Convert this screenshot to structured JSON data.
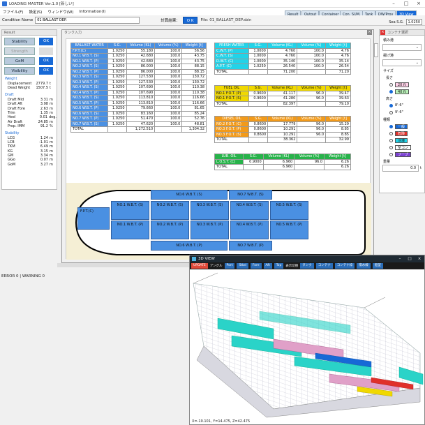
{
  "app": {
    "title": "LOADING MASTER Ver.1.0 [新しい]",
    "menu": [
      "ファイル(F)",
      "設定(S)",
      "ウィンドウ(W)",
      "Information(I)"
    ],
    "condition_label": "Condition Name",
    "condition_value": "01 BALLAST DEP.",
    "calc_label": "計算結果：",
    "ok_label": "O K",
    "file_label": "File: 01_BALLAST_DEP.sbin",
    "top_buttons": [
      "Result",
      "Output",
      "Container",
      "Con. SUM.",
      "Tank",
      "DW/Prov",
      "3D View"
    ],
    "sea_sg_label": "Sea S.G.",
    "sea_sg_value": "1.0250",
    "error_line": "ERROR 0 | WARNING 0"
  },
  "result": {
    "title": "Result",
    "buttons": [
      {
        "label": "Stability",
        "ok": "OK"
      },
      {
        "label": "Strength",
        "ok": ""
      },
      {
        "label": "GoM",
        "ok": "OK"
      },
      {
        "label": "Visibility",
        "ok": "OK"
      }
    ],
    "weight_title": "Weight",
    "weight": [
      {
        "l": "Displacement",
        "v": "2779.7",
        "u": "t"
      },
      {
        "l": "Dead Weight",
        "v": "1507.5",
        "u": "t"
      }
    ],
    "draft_title": "Draft",
    "draft": [
      {
        "l": "Draft Mid",
        "v": "3.31",
        "u": "m"
      },
      {
        "l": "Draft Aft",
        "v": "3.98",
        "u": "m"
      },
      {
        "l": "Draft Fore",
        "v": "2.63",
        "u": "m"
      },
      {
        "l": "Trim",
        "v": "1.35",
        "u": "m"
      },
      {
        "l": "Heel",
        "v": "0.01",
        "u": "deg."
      },
      {
        "l": "Air Draft",
        "v": "24.85",
        "u": "m"
      },
      {
        "l": "Prop. IMM",
        "v": "91.2",
        "u": "%"
      }
    ],
    "stab_title": "Stability",
    "stab": [
      {
        "l": "LCG",
        "v": "1.24",
        "u": "m"
      },
      {
        "l": "LCB",
        "v": "-1.01",
        "u": "m"
      },
      {
        "l": "TKM",
        "v": "6.49",
        "u": "m"
      },
      {
        "l": "KG",
        "v": "3.15",
        "u": "m"
      },
      {
        "l": "GM",
        "v": "3.34",
        "u": "m"
      },
      {
        "l": "GGo",
        "v": "0.07",
        "u": "m"
      },
      {
        "l": "GoM",
        "v": "3.27",
        "u": "m"
      }
    ]
  },
  "mainwin": {
    "title": "タンク入力"
  },
  "ballast": {
    "headers": [
      "BALLAST WATER",
      "S.G.",
      "Volume (KL)",
      "Volume (%)",
      "Weight [t]"
    ],
    "rows": [
      [
        "F.P.T.(C)",
        "1.0250",
        "55.180",
        "100.0",
        "56.56"
      ],
      [
        "NO.1 W.B.T. (S)",
        "1.0250",
        "42.680",
        "100.0",
        "43.75"
      ],
      [
        "NO.1 W.B.T. (P)",
        "1.0250",
        "42.680",
        "100.0",
        "43.75"
      ],
      [
        "NO.2 W.B.T. (S)",
        "1.0250",
        "86.000",
        "100.0",
        "88.15"
      ],
      [
        "NO.2 W.B.T. (P)",
        "1.0250",
        "86.000",
        "100.0",
        "88.15"
      ],
      [
        "NO.3 W.B.T. (S)",
        "1.0250",
        "127.530",
        "100.0",
        "130.72"
      ],
      [
        "NO.3 W.B.T. (P)",
        "1.0250",
        "127.530",
        "100.0",
        "130.72"
      ],
      [
        "NO.4 W.B.T. (S)",
        "1.0250",
        "107.690",
        "100.0",
        "110.38"
      ],
      [
        "NO.4 W.B.T. (P)",
        "1.0250",
        "107.690",
        "100.0",
        "110.38"
      ],
      [
        "NO.5 W.B.T. (S)",
        "1.0250",
        "113.810",
        "100.0",
        "116.66"
      ],
      [
        "NO.5 W.B.T. (P)",
        "1.0250",
        "113.810",
        "100.0",
        "116.66"
      ],
      [
        "NO.6 W.B.T. (P)",
        "1.0250",
        "79.660",
        "100.0",
        "81.65"
      ],
      [
        "NO.6 W.B.T. (S)",
        "1.0250",
        "83.160",
        "100.0",
        "85.24"
      ],
      [
        "NO.7 W.B.T. (P)",
        "1.0250",
        "51.470",
        "100.0",
        "52.76"
      ],
      [
        "NO.7 W.B.T. (S)",
        "1.0250",
        "47.620",
        "100.0",
        "48.81"
      ]
    ],
    "total": [
      "TOTAL",
      "",
      "1,272.510",
      "",
      "1,304.32"
    ]
  },
  "fresh": {
    "headers": [
      "FRESH WATER",
      "S.G.",
      "Volume (KL)",
      "Volume (%)",
      "Weight [t]"
    ],
    "rows": [
      [
        "C.W.T. (P)",
        "1.0000",
        "4.760",
        "100.0",
        "4.76"
      ],
      [
        "C.W.T. (S)",
        "1.0000",
        "4.760",
        "100.0",
        "4.76"
      ],
      [
        "D.W.T. (C)",
        "1.0000",
        "35.140",
        "100.0",
        "35.14"
      ],
      [
        "A.P.T. (C)",
        "1.0250",
        "26.540",
        "100.0",
        "26.54"
      ]
    ],
    "total": [
      "TOTAL",
      "",
      "71.200",
      "",
      "71.20"
    ]
  },
  "fuel": {
    "headers": [
      "FUEL OIL",
      "S.G.",
      "Volume (KL)",
      "Volume (%)",
      "Weight [t]"
    ],
    "rows": [
      [
        "NO.1 F.O.T. (P)",
        "0.9600",
        "41.117",
        "96.0",
        "39.47"
      ],
      [
        "NO.1 F.O.T. (S)",
        "0.9600",
        "41.280",
        "96.0",
        "39.63"
      ]
    ],
    "total": [
      "TOTAL",
      "",
      "82.397",
      "",
      "79.10"
    ]
  },
  "diesel": {
    "headers": [
      "DIESEL OIL",
      "S.G.",
      "Volume (KL)",
      "Volume (%)",
      "Weight [t]"
    ],
    "rows": [
      [
        "NO.2 F.O.T. (C)",
        "0.8600",
        "17.779",
        "96.0",
        "15.29"
      ],
      [
        "NO.3 F.O.T. (P)",
        "0.8600",
        "10.291",
        "96.0",
        "8.85"
      ],
      [
        "NO.3 F.O.T. (S)",
        "0.8600",
        "10.291",
        "96.0",
        "8.85"
      ]
    ],
    "total": [
      "TOTAL",
      "",
      "38.362",
      "",
      "32.99"
    ]
  },
  "lube": {
    "headers": [
      "LUB. OIL",
      "S.G.",
      "Volume (KL)",
      "Volume (%)",
      "Weight [t]"
    ],
    "rows": [
      [
        "L.O.S.T. (C)",
        "0.9000",
        "6.960",
        "96.0",
        "6.26"
      ]
    ],
    "total": [
      "TOTAL",
      "",
      "6.960",
      "",
      "6.26"
    ]
  },
  "diagram": {
    "tanks": {
      "fpt": "F.P.T.(C)",
      "n6s": "NO.6 W.B.T. (S)",
      "n7s": "NO.7 W.B.T. (S)",
      "n1s": "NO.1 W.B.T. (S)",
      "n2s": "NO.2 W.B.T. (S)",
      "n3s": "NO.3 W.B.T. (S)",
      "n4s": "NO.4 W.B.T. (S)",
      "n5s": "NO.5 W.B.T. (S)",
      "n1p": "NO.1 W.B.T. (P)",
      "n2p": "NO.2 W.B.T. (P)",
      "n3p": "NO.3 W.B.T. (P)",
      "n4p": "NO.4 W.B.T. (P)",
      "n5p": "NO.5 W.B.T. (P)",
      "n6p": "NO.6 W.B.T. (P)",
      "n7p": "NO.7 W.B.T. (P)"
    }
  },
  "rightpanel": {
    "title": "コンテナ選択",
    "load_port": "積み港",
    "disch_port": "揚げ港",
    "size": "サイズ",
    "length": "長さ",
    "len_opts": [
      "20 ft",
      "40 ft"
    ],
    "height": "高さ",
    "h_opts": [
      "8'-6\"",
      "9'-6\""
    ],
    "kind": "種類",
    "kinds": [
      "一般",
      "危険",
      "冷凍",
      "空コン",
      "フープ"
    ],
    "weight_lbl": "重量",
    "weight_val": "0.0",
    "weight_unit": "t",
    "colors": {
      "general": "#1769d6",
      "danger": "#e0302a",
      "reefer": "#22d3e8",
      "empty": "#ffffff",
      "hoop": "#7a3fd1"
    }
  },
  "view3d": {
    "title": "3D VIEW",
    "tools": [
      "UPDATE",
      "アングル",
      "Port",
      "Stbd",
      "Fore",
      "Aft",
      "Top",
      "表示切替",
      "タンク",
      "コンテナ",
      "コンテナ枠",
      "喫水線",
      "船型"
    ],
    "coord": "X=-10.101, Y=14.475, Z=42.475"
  }
}
